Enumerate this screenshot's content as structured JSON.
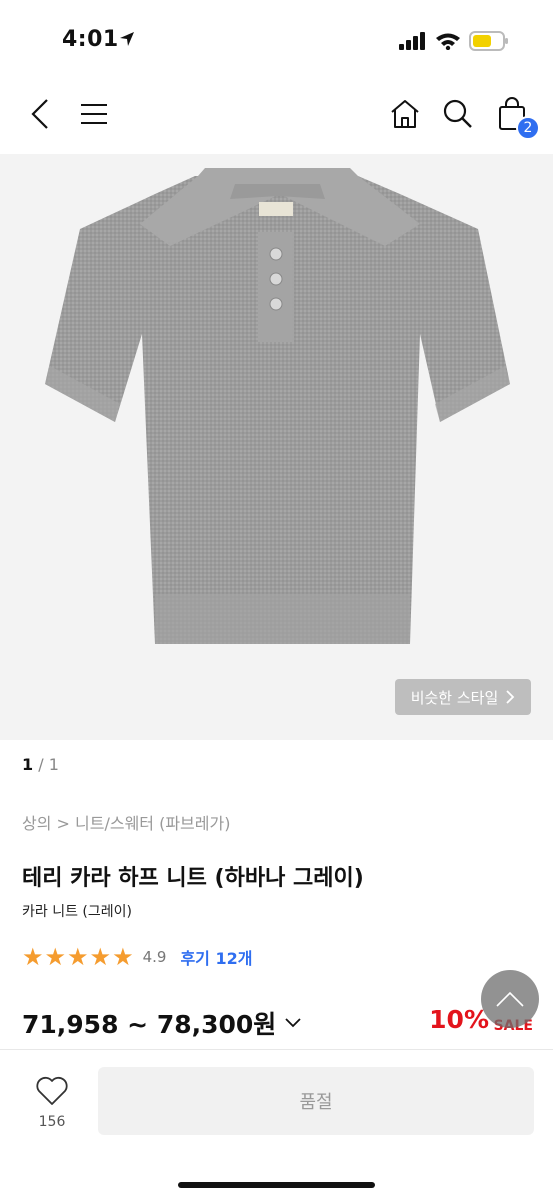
{
  "status": {
    "time": "4:01",
    "location_icon": "location-arrow-icon",
    "signal_icon": "cellular-signal-icon",
    "wifi_icon": "wifi-icon",
    "battery_icon": "battery-low-icon",
    "battery_color": "#f2d100"
  },
  "nav": {
    "back_icon": "chevron-left-icon",
    "menu_icon": "hamburger-menu-icon",
    "home_icon": "home-icon",
    "search_icon": "search-icon",
    "cart_icon": "shopping-bag-icon",
    "cart_count": "2",
    "accent": "#2f6ef0"
  },
  "gallery": {
    "similar_style": "비슷한 스타일",
    "page_current": "1",
    "page_total": "1"
  },
  "product": {
    "breadcrumb": "상의 > 니트/스웨터 (파브레가)",
    "title": "테리 카라 하프 니트 (하바나 그레이)",
    "subtitle": "카라 니트 (그레이)",
    "stars": "★★★★★",
    "rating": "4.9",
    "reviews": "후기 12개",
    "price": "71,958 ~ 78,300원",
    "discount": "10%",
    "sale_label": "SALE",
    "star_color": "#f59c2f",
    "discount_color": "#e3141c"
  },
  "bottom": {
    "like_count": "156",
    "soldout_label": "품절"
  }
}
